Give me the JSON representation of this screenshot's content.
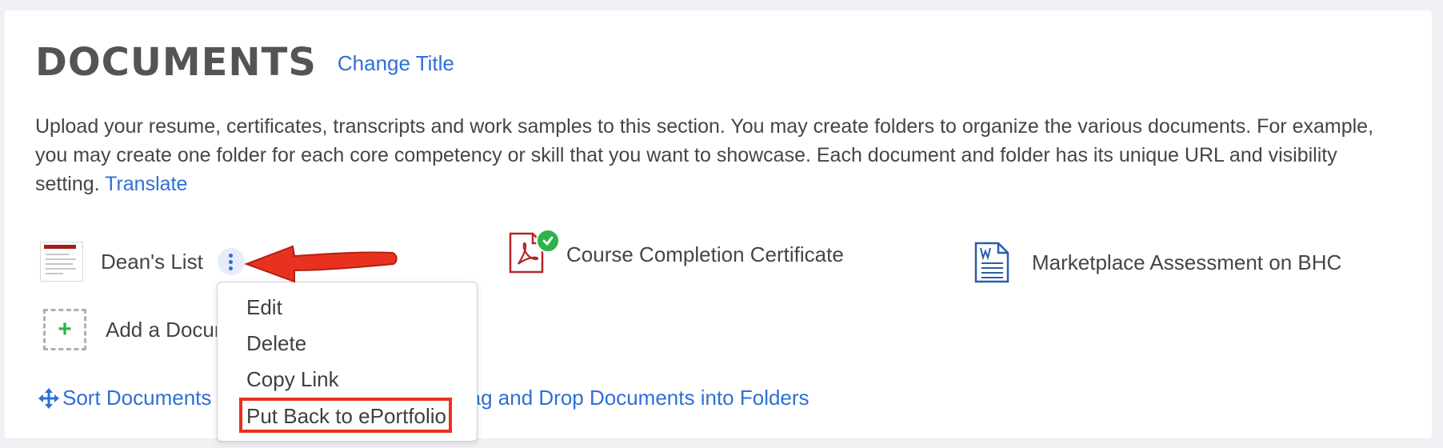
{
  "section": {
    "title": "DOCUMENTS",
    "change_title": "Change Title",
    "description": "Upload your resume, certificates, transcripts and work samples to this section. You may create folders to organize the various documents. For example, you may create one folder for each core competency or skill that you want to showcase. Each document and folder has its unique URL and visibility setting.",
    "translate": "Translate"
  },
  "documents": [
    {
      "label": "Dean's List",
      "icon": "document-thumbnail-icon"
    },
    {
      "label": "Course Completion Certificate",
      "icon": "pdf-icon",
      "status": "check-icon"
    },
    {
      "label": "Marketplace Assessment on BHC",
      "icon": "word-doc-icon"
    }
  ],
  "add_document": {
    "label": "Add a Docum",
    "icon": "plus-icon"
  },
  "footer": {
    "sort_label": "Sort Documents",
    "drag_label": "rag and Drop Documents into Folders"
  },
  "context_menu": {
    "items": [
      "Edit",
      "Delete",
      "Copy Link",
      "Put Back to ePortfolio"
    ],
    "highlighted_index": 3
  },
  "colors": {
    "link": "#2e6fd6",
    "highlight_border": "#e8321f",
    "arrow": "#e8321f",
    "check": "#2db34a"
  }
}
